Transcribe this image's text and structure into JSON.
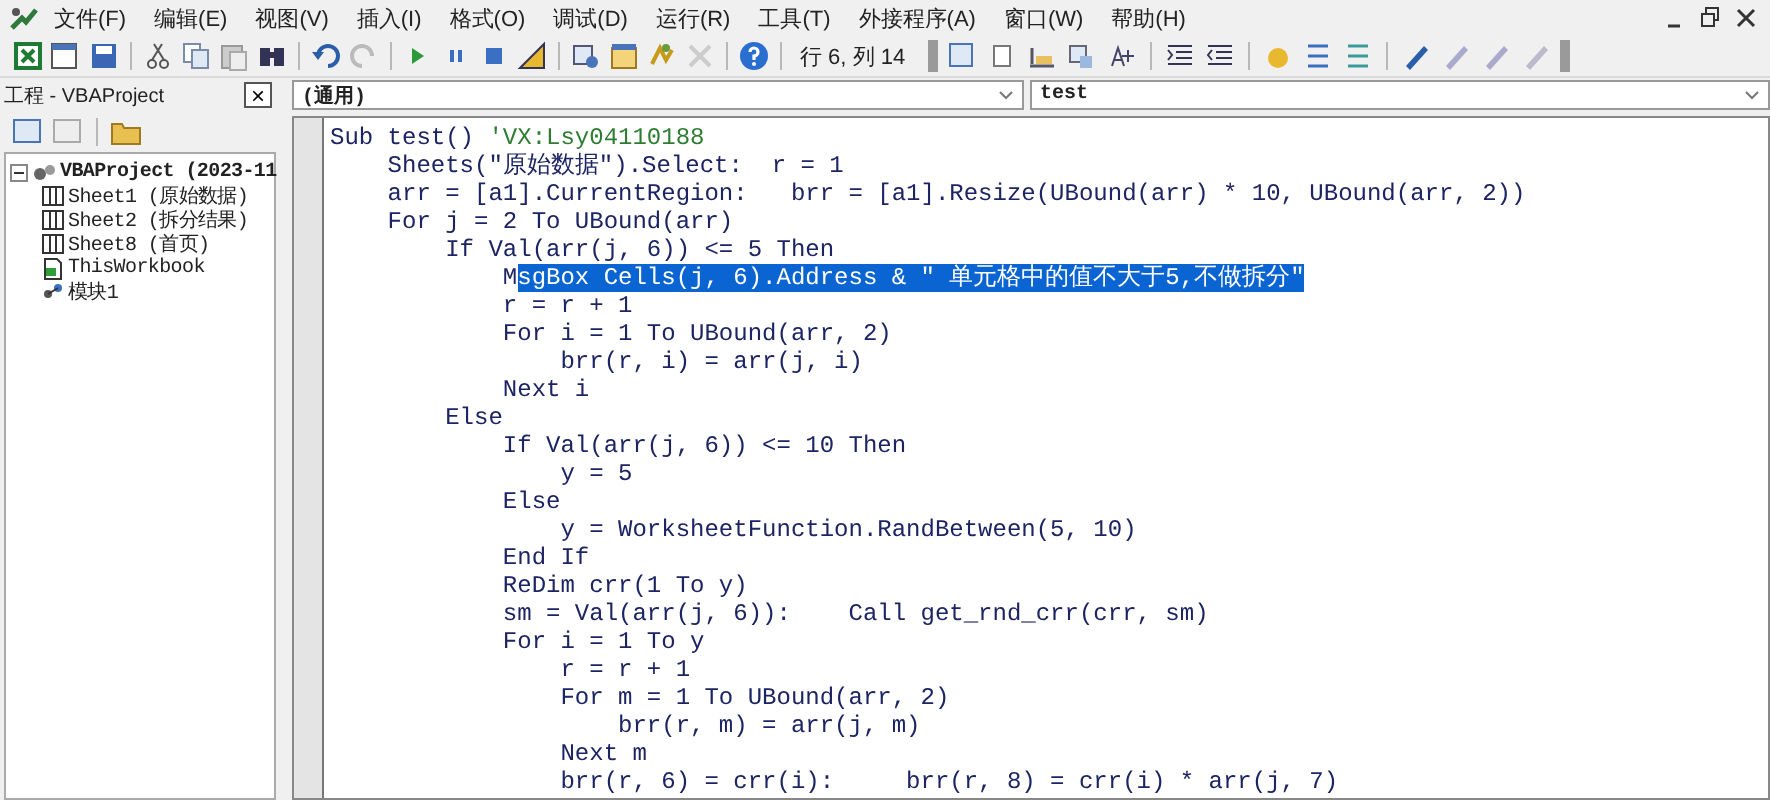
{
  "menu": [
    {
      "label": "文件(F)"
    },
    {
      "label": "编辑(E)"
    },
    {
      "label": "视图(V)"
    },
    {
      "label": "插入(I)"
    },
    {
      "label": "格式(O)"
    },
    {
      "label": "调试(D)"
    },
    {
      "label": "运行(R)"
    },
    {
      "label": "工具(T)"
    },
    {
      "label": "外接程序(A)"
    },
    {
      "label": "窗口(W)"
    },
    {
      "label": "帮助(H)"
    }
  ],
  "toolbar": {
    "cursor_position": "行 6, 列 14"
  },
  "project_pane": {
    "title": "工程 - VBAProject",
    "close": "×",
    "tree": [
      {
        "label": "VBAProject (2023-11",
        "expanded": true,
        "children": [
          {
            "label": "Sheet1 (原始数据)",
            "kind": "sheet"
          },
          {
            "label": "Sheet2 (拆分结果)",
            "kind": "sheet"
          },
          {
            "label": "Sheet8 (首页)",
            "kind": "sheet"
          },
          {
            "label": "ThisWorkbook",
            "kind": "workbook"
          },
          {
            "label": "模块1",
            "kind": "module"
          }
        ]
      }
    ]
  },
  "code_window": {
    "object_dropdown": "(通用)",
    "procedure_dropdown": "test",
    "lines": [
      [
        {
          "text": "Sub test() ",
          "kind": "code"
        },
        {
          "text": "'VX:Lsy04110188",
          "kind": "comment"
        }
      ],
      [
        {
          "text": "    Sheets(\"原始数据\").Select:  r = 1",
          "kind": "code"
        }
      ],
      [
        {
          "text": "    arr = [a1].CurrentRegion:   brr = [a1].Resize(UBound(arr) * 10, UBound(arr, 2))",
          "kind": "code"
        }
      ],
      [
        {
          "text": "    For j = 2 To UBound(arr)",
          "kind": "code"
        }
      ],
      [
        {
          "text": "        If Val(arr(j, 6)) <= 5 Then",
          "kind": "code"
        }
      ],
      [
        {
          "text": "            M",
          "kind": "code"
        },
        {
          "text": "sgBox Cells(j, 6).Address & \" 单元格中的值不大于5,不做拆分\"",
          "kind": "selected"
        }
      ],
      [
        {
          "text": "            r = r + 1",
          "kind": "code"
        }
      ],
      [
        {
          "text": "            For i = 1 To UBound(arr, 2)",
          "kind": "code"
        }
      ],
      [
        {
          "text": "                brr(r, i) = arr(j, i)",
          "kind": "code"
        }
      ],
      [
        {
          "text": "            Next i",
          "kind": "code"
        }
      ],
      [
        {
          "text": "        Else",
          "kind": "code"
        }
      ],
      [
        {
          "text": "            If Val(arr(j, 6)) <= 10 Then",
          "kind": "code"
        }
      ],
      [
        {
          "text": "                y = 5",
          "kind": "code"
        }
      ],
      [
        {
          "text": "            Else",
          "kind": "code"
        }
      ],
      [
        {
          "text": "                y = WorksheetFunction.RandBetween(5, 10)",
          "kind": "code"
        }
      ],
      [
        {
          "text": "            End If",
          "kind": "code"
        }
      ],
      [
        {
          "text": "            ReDim crr(1 To y)",
          "kind": "code"
        }
      ],
      [
        {
          "text": "            sm = Val(arr(j, 6)):    Call get_rnd_crr(crr, sm)",
          "kind": "code"
        }
      ],
      [
        {
          "text": "            For i = 1 To y",
          "kind": "code"
        }
      ],
      [
        {
          "text": "                r = r + 1",
          "kind": "code"
        }
      ],
      [
        {
          "text": "                For m = 1 To UBound(arr, 2)",
          "kind": "code"
        }
      ],
      [
        {
          "text": "                    brr(r, m) = arr(j, m)",
          "kind": "code"
        }
      ],
      [
        {
          "text": "                Next m",
          "kind": "code"
        }
      ],
      [
        {
          "text": "                brr(r, 6) = crr(i):     brr(r, 8) = crr(i) * arr(j, 7)",
          "kind": "code"
        }
      ]
    ]
  }
}
